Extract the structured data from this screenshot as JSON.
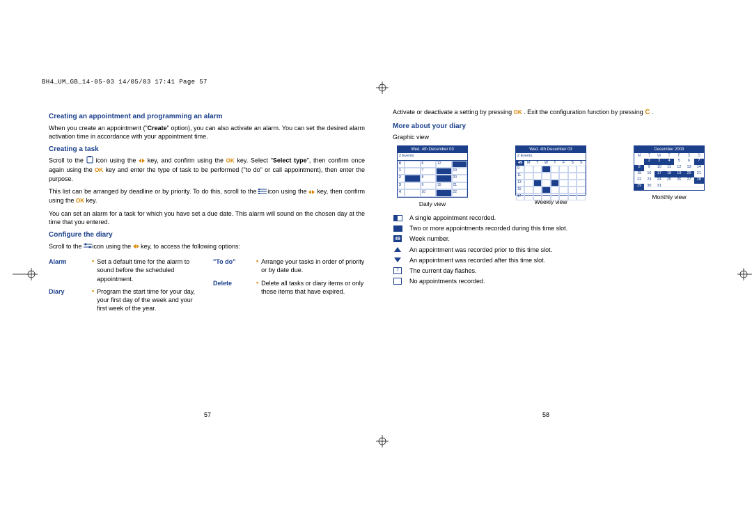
{
  "header": "BH4_UM_GB_14-05-03  14/05/03  17:41  Page 57",
  "left": {
    "h1": "Creating an appointment and programming an alarm",
    "p1a": "When you create an appointment (\"",
    "p1b": "Create",
    "p1c": "\" option), you can also activate an alarm. You can set the desired alarm activation time in accordance with your appointment time.",
    "h2": "Creating a task",
    "p2a": "Scroll to the ",
    "p2b": " icon using the ",
    "p2c": " key, and confirm using the ",
    "p2d": " key. Select \"",
    "p2e": "Select type",
    "p2f": "\", then confirm once again using the ",
    "p2g": " key and enter the type of task to be performed (\"to do\" or call appointment), then enter the purpose.",
    "p3a": "This list can be arranged by deadline or by priority. To do this, scroll to the ",
    "p3b": " icon using the ",
    "p3c": " key, then confirm using the ",
    "p3d": " key.",
    "p4": "You can set an alarm for a task for which you have set a due date. This alarm will sound on the chosen day at the time that you entered.",
    "h3": "Configure the diary",
    "p5a": "Scroll to the ",
    "p5b": " icon using the ",
    "p5c": " key, to access the following options:",
    "tbl": {
      "alarm": {
        "label": "Alarm",
        "text": "Set a default time for the alarm to sound before the scheduled appointment."
      },
      "diary": {
        "label": "Diary",
        "text": "Program the start time for your day, your first day of the week and your first week of the year."
      },
      "todo": {
        "label": "\"To do\"",
        "text": "Arrange your tasks in order of priority or by date due."
      },
      "delete": {
        "label": "Delete",
        "text": "Delete all tasks or diary items or only those items that have expired."
      }
    },
    "pagenum": "57"
  },
  "right": {
    "top1": "Activate or deactivate a setting by pressing ",
    "top2": ". Exit the configuration function by pressing ",
    "top3": ".",
    "h1": "More about your diary",
    "sub": "Graphic view",
    "views": {
      "daily": {
        "title": "Wed. 4th December 03",
        "sub": "2 Events",
        "caption": "Daily view"
      },
      "weekly": {
        "title": "Wed. 4th December 03",
        "sub": "2 Events",
        "caption": "Weekly view",
        "wk": "49",
        "days": "M T W T F S S"
      },
      "monthly": {
        "title": "December 2003",
        "caption": "Monthly view",
        "days": "M T W T F S S"
      }
    },
    "legend": {
      "single": "A single appointment recorded.",
      "multi": "Two or more appointments recorded during this time slot.",
      "week": "Week number.",
      "wknum": "49",
      "before": "An appointment was recorded prior to this time slot.",
      "after": "An appointment was recorded after this time slot.",
      "flash": "The current day flashes.",
      "flashnum": "7",
      "none": "No appointments recorded."
    },
    "pagenum": "58"
  },
  "ok": "OK",
  "c": "C"
}
